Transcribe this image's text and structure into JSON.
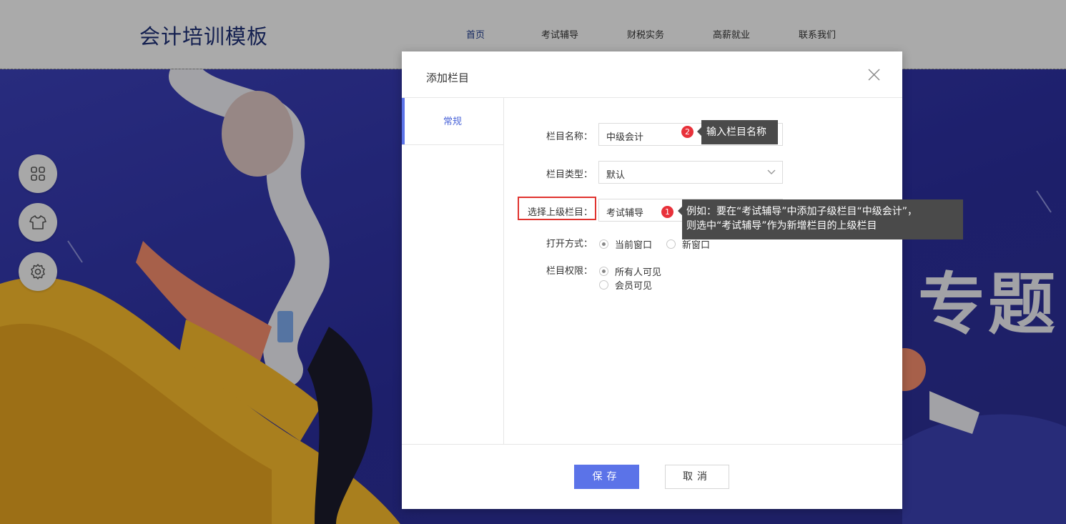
{
  "site": {
    "logo": "会计培训模板",
    "nav": [
      {
        "label": "首页",
        "active": true
      },
      {
        "label": "考试辅导",
        "active": false
      },
      {
        "label": "财税实务",
        "active": false
      },
      {
        "label": "高薪就业",
        "active": false
      },
      {
        "label": "联系我们",
        "active": false
      }
    ],
    "banner_text": "专题",
    "side_tools": [
      {
        "icon": "grid-icon"
      },
      {
        "icon": "tshirt-icon"
      },
      {
        "icon": "gear-icon"
      }
    ]
  },
  "modal": {
    "title": "添加栏目",
    "tabs": [
      {
        "label": "常规",
        "active": true
      }
    ],
    "form": {
      "name": {
        "label": "栏目名称：",
        "value": "中级会计"
      },
      "type": {
        "label": "栏目类型：",
        "value": "默认"
      },
      "parent": {
        "label": "选择上级栏目：",
        "value": "考试辅导"
      },
      "open_mode": {
        "label": "打开方式：",
        "options": [
          {
            "label": "当前窗口",
            "checked": true
          },
          {
            "label": "新窗口",
            "checked": false
          }
        ]
      },
      "permission": {
        "label": "栏目权限：",
        "options": [
          {
            "label": "所有人可见",
            "checked": true
          },
          {
            "label": "会员可见",
            "checked": false
          }
        ]
      }
    },
    "annotations": {
      "one": {
        "number": "1",
        "line1": "例如：要在“考试辅导”中添加子级栏目“中级会计”，",
        "line2": "则选中“考试辅导”作为新增栏目的上级栏目"
      },
      "two": {
        "number": "2",
        "text": "输入栏目名称"
      }
    },
    "buttons": {
      "save": "保存",
      "cancel": "取消"
    }
  },
  "colors": {
    "accent": "#5b73e8",
    "highlight": "#e0332f",
    "badge": "#e8313a",
    "tooltip": "#4a4a4a",
    "logo": "#1e2f73"
  }
}
